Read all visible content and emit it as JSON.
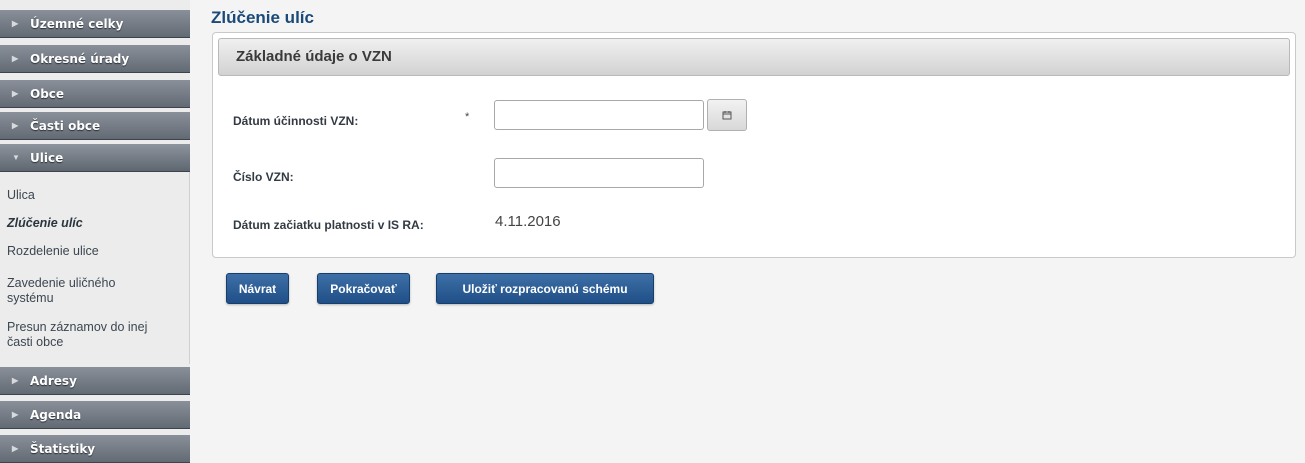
{
  "sidebar": {
    "sections": [
      {
        "label": "Územné celky",
        "expanded": false
      },
      {
        "label": "Okresné úrady",
        "expanded": false
      },
      {
        "label": "Obce",
        "expanded": false
      },
      {
        "label": "Časti obce",
        "expanded": false
      },
      {
        "label": "Ulice",
        "expanded": true
      },
      {
        "label": "Adresy",
        "expanded": false
      },
      {
        "label": "Agenda",
        "expanded": false
      },
      {
        "label": "Štatistiky",
        "expanded": false
      }
    ],
    "submenu": [
      {
        "label": "Ulica"
      },
      {
        "label": "Zlúčenie ulíc",
        "active": true
      },
      {
        "label": "Rozdelenie ulice"
      },
      {
        "label": "Zavedenie uličného systému"
      },
      {
        "label": "Presun záznamov do inej časti obce"
      }
    ]
  },
  "main": {
    "title": "Zlúčenie ulíc",
    "panel": {
      "header": "Základné údaje o VZN",
      "fields": {
        "effective_date": {
          "label": "Dátum účinnosti VZN:",
          "required_mark": "*",
          "value": "",
          "icon": "calendar-icon"
        },
        "vzn_number": {
          "label": "Číslo VZN:",
          "value": ""
        },
        "validity_start": {
          "label": "Dátum začiatku platnosti v IS RA:",
          "value": "4.11.2016"
        }
      }
    },
    "buttons": {
      "back": "Návrat",
      "continue": "Pokračovať",
      "save_draft": "Uložiť rozpracovanú schému"
    }
  },
  "colors": {
    "accent": "#1f4f86",
    "title": "#1b4a78",
    "sidebar_header": "#6b727b"
  }
}
